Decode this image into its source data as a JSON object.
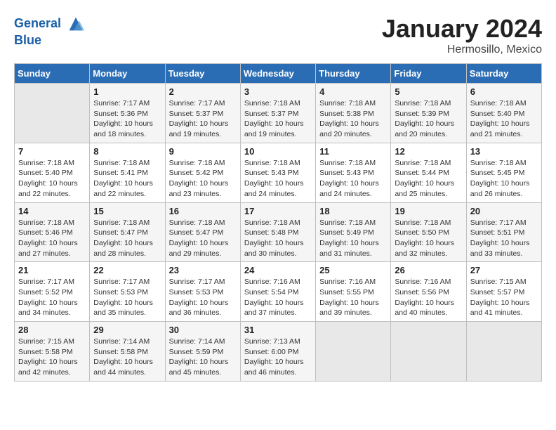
{
  "header": {
    "logo_line1": "General",
    "logo_line2": "Blue",
    "month": "January 2024",
    "location": "Hermosillo, Mexico"
  },
  "weekdays": [
    "Sunday",
    "Monday",
    "Tuesday",
    "Wednesday",
    "Thursday",
    "Friday",
    "Saturday"
  ],
  "weeks": [
    [
      {
        "day": "",
        "empty": true
      },
      {
        "day": "1",
        "sunrise": "Sunrise: 7:17 AM",
        "sunset": "Sunset: 5:36 PM",
        "daylight": "Daylight: 10 hours and 18 minutes."
      },
      {
        "day": "2",
        "sunrise": "Sunrise: 7:17 AM",
        "sunset": "Sunset: 5:37 PM",
        "daylight": "Daylight: 10 hours and 19 minutes."
      },
      {
        "day": "3",
        "sunrise": "Sunrise: 7:18 AM",
        "sunset": "Sunset: 5:37 PM",
        "daylight": "Daylight: 10 hours and 19 minutes."
      },
      {
        "day": "4",
        "sunrise": "Sunrise: 7:18 AM",
        "sunset": "Sunset: 5:38 PM",
        "daylight": "Daylight: 10 hours and 20 minutes."
      },
      {
        "day": "5",
        "sunrise": "Sunrise: 7:18 AM",
        "sunset": "Sunset: 5:39 PM",
        "daylight": "Daylight: 10 hours and 20 minutes."
      },
      {
        "day": "6",
        "sunrise": "Sunrise: 7:18 AM",
        "sunset": "Sunset: 5:40 PM",
        "daylight": "Daylight: 10 hours and 21 minutes."
      }
    ],
    [
      {
        "day": "7",
        "sunrise": "Sunrise: 7:18 AM",
        "sunset": "Sunset: 5:40 PM",
        "daylight": "Daylight: 10 hours and 22 minutes."
      },
      {
        "day": "8",
        "sunrise": "Sunrise: 7:18 AM",
        "sunset": "Sunset: 5:41 PM",
        "daylight": "Daylight: 10 hours and 22 minutes."
      },
      {
        "day": "9",
        "sunrise": "Sunrise: 7:18 AM",
        "sunset": "Sunset: 5:42 PM",
        "daylight": "Daylight: 10 hours and 23 minutes."
      },
      {
        "day": "10",
        "sunrise": "Sunrise: 7:18 AM",
        "sunset": "Sunset: 5:43 PM",
        "daylight": "Daylight: 10 hours and 24 minutes."
      },
      {
        "day": "11",
        "sunrise": "Sunrise: 7:18 AM",
        "sunset": "Sunset: 5:43 PM",
        "daylight": "Daylight: 10 hours and 24 minutes."
      },
      {
        "day": "12",
        "sunrise": "Sunrise: 7:18 AM",
        "sunset": "Sunset: 5:44 PM",
        "daylight": "Daylight: 10 hours and 25 minutes."
      },
      {
        "day": "13",
        "sunrise": "Sunrise: 7:18 AM",
        "sunset": "Sunset: 5:45 PM",
        "daylight": "Daylight: 10 hours and 26 minutes."
      }
    ],
    [
      {
        "day": "14",
        "sunrise": "Sunrise: 7:18 AM",
        "sunset": "Sunset: 5:46 PM",
        "daylight": "Daylight: 10 hours and 27 minutes."
      },
      {
        "day": "15",
        "sunrise": "Sunrise: 7:18 AM",
        "sunset": "Sunset: 5:47 PM",
        "daylight": "Daylight: 10 hours and 28 minutes."
      },
      {
        "day": "16",
        "sunrise": "Sunrise: 7:18 AM",
        "sunset": "Sunset: 5:47 PM",
        "daylight": "Daylight: 10 hours and 29 minutes."
      },
      {
        "day": "17",
        "sunrise": "Sunrise: 7:18 AM",
        "sunset": "Sunset: 5:48 PM",
        "daylight": "Daylight: 10 hours and 30 minutes."
      },
      {
        "day": "18",
        "sunrise": "Sunrise: 7:18 AM",
        "sunset": "Sunset: 5:49 PM",
        "daylight": "Daylight: 10 hours and 31 minutes."
      },
      {
        "day": "19",
        "sunrise": "Sunrise: 7:18 AM",
        "sunset": "Sunset: 5:50 PM",
        "daylight": "Daylight: 10 hours and 32 minutes."
      },
      {
        "day": "20",
        "sunrise": "Sunrise: 7:17 AM",
        "sunset": "Sunset: 5:51 PM",
        "daylight": "Daylight: 10 hours and 33 minutes."
      }
    ],
    [
      {
        "day": "21",
        "sunrise": "Sunrise: 7:17 AM",
        "sunset": "Sunset: 5:52 PM",
        "daylight": "Daylight: 10 hours and 34 minutes."
      },
      {
        "day": "22",
        "sunrise": "Sunrise: 7:17 AM",
        "sunset": "Sunset: 5:53 PM",
        "daylight": "Daylight: 10 hours and 35 minutes."
      },
      {
        "day": "23",
        "sunrise": "Sunrise: 7:17 AM",
        "sunset": "Sunset: 5:53 PM",
        "daylight": "Daylight: 10 hours and 36 minutes."
      },
      {
        "day": "24",
        "sunrise": "Sunrise: 7:16 AM",
        "sunset": "Sunset: 5:54 PM",
        "daylight": "Daylight: 10 hours and 37 minutes."
      },
      {
        "day": "25",
        "sunrise": "Sunrise: 7:16 AM",
        "sunset": "Sunset: 5:55 PM",
        "daylight": "Daylight: 10 hours and 39 minutes."
      },
      {
        "day": "26",
        "sunrise": "Sunrise: 7:16 AM",
        "sunset": "Sunset: 5:56 PM",
        "daylight": "Daylight: 10 hours and 40 minutes."
      },
      {
        "day": "27",
        "sunrise": "Sunrise: 7:15 AM",
        "sunset": "Sunset: 5:57 PM",
        "daylight": "Daylight: 10 hours and 41 minutes."
      }
    ],
    [
      {
        "day": "28",
        "sunrise": "Sunrise: 7:15 AM",
        "sunset": "Sunset: 5:58 PM",
        "daylight": "Daylight: 10 hours and 42 minutes."
      },
      {
        "day": "29",
        "sunrise": "Sunrise: 7:14 AM",
        "sunset": "Sunset: 5:58 PM",
        "daylight": "Daylight: 10 hours and 44 minutes."
      },
      {
        "day": "30",
        "sunrise": "Sunrise: 7:14 AM",
        "sunset": "Sunset: 5:59 PM",
        "daylight": "Daylight: 10 hours and 45 minutes."
      },
      {
        "day": "31",
        "sunrise": "Sunrise: 7:13 AM",
        "sunset": "Sunset: 6:00 PM",
        "daylight": "Daylight: 10 hours and 46 minutes."
      },
      {
        "day": "",
        "empty": true
      },
      {
        "day": "",
        "empty": true
      },
      {
        "day": "",
        "empty": true
      }
    ]
  ]
}
